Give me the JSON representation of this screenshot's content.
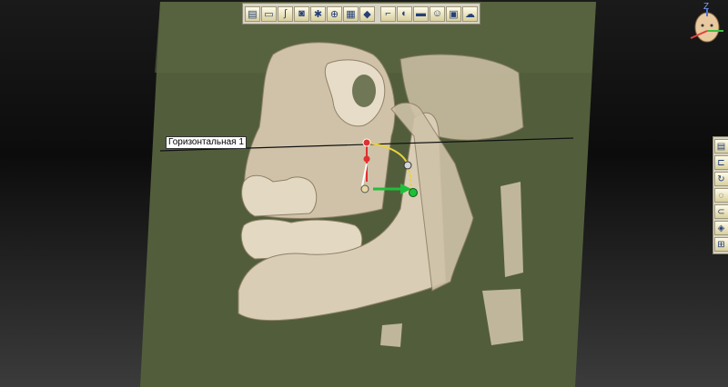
{
  "plane_label": "Горизонтальная 1",
  "orientation_axis": "Z",
  "toolbar_top": [
    {
      "name": "implant-view-icon"
    },
    {
      "name": "panorama-icon"
    },
    {
      "name": "curve-icon"
    },
    {
      "name": "cube-3d-icon"
    },
    {
      "name": "nerve-icon"
    },
    {
      "name": "globe-icon"
    },
    {
      "name": "volume-icon"
    },
    {
      "name": "bone-render-icon"
    },
    {
      "name": "implant-tool-icon"
    },
    {
      "name": "tooth-icon"
    },
    {
      "name": "window-level-icon"
    },
    {
      "name": "face-icon"
    },
    {
      "name": "layout-icon"
    },
    {
      "name": "cloud-icon"
    }
  ],
  "toolbar_right": [
    {
      "name": "implant-side-icon"
    },
    {
      "name": "crop-icon"
    },
    {
      "name": "rotate-icon"
    },
    {
      "name": "clip-icon"
    },
    {
      "name": "lasso-icon"
    },
    {
      "name": "color-icon"
    },
    {
      "name": "export-icon"
    }
  ],
  "colors": {
    "plane": "#525e3b",
    "bone": "#d9cdb6",
    "bone_shadow": "#8f8168",
    "label_bg": "#ffffff",
    "gizmo_green": "#1fbf3a",
    "gizmo_red": "#e03030",
    "gizmo_yellow": "#e8d23a"
  }
}
